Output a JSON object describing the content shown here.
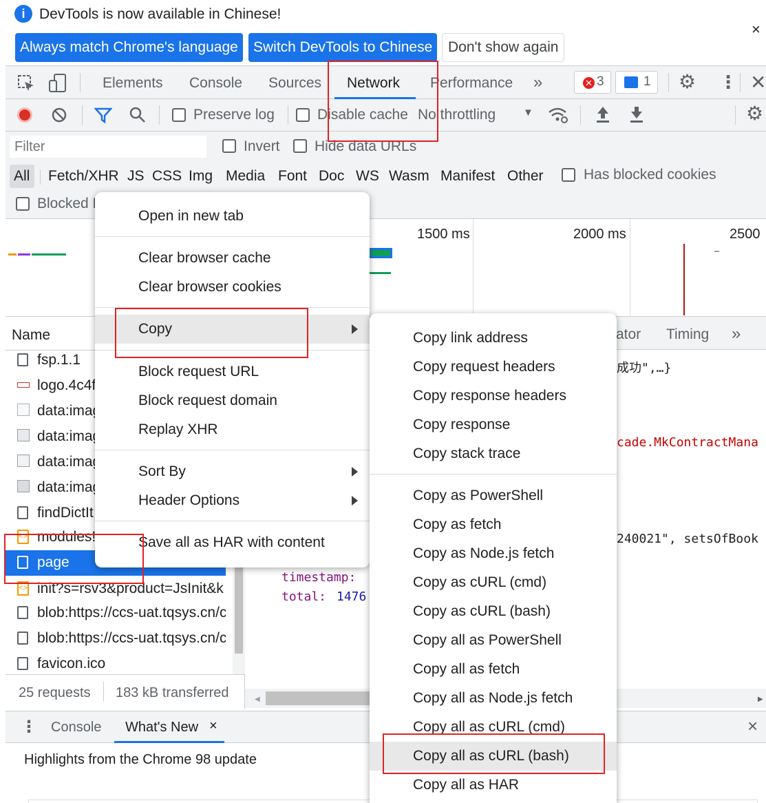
{
  "infobar": {
    "message": "DevTools is now available in Chinese!",
    "btn_match": "Always match Chrome's language",
    "btn_switch": "Switch DevTools to Chinese",
    "btn_dont_show": "Don't show again",
    "close": "×"
  },
  "tabs": {
    "elements": "Elements",
    "console": "Console",
    "sources": "Sources",
    "network": "Network",
    "performance": "Performance",
    "more": "»",
    "errors_count": "3",
    "messages_count": "1"
  },
  "netbar": {
    "preserve_log": "Preserve log",
    "disable_cache": "Disable cache",
    "throttling": "No throttling"
  },
  "filter": {
    "placeholder": "Filter",
    "invert": "Invert",
    "hide_data_urls": "Hide data URLs",
    "types": [
      "All",
      "Fetch/XHR",
      "JS",
      "CSS",
      "Img",
      "Media",
      "Font",
      "Doc",
      "WS",
      "Wasm",
      "Manifest",
      "Other"
    ],
    "has_blocked_cookies": "Has blocked cookies",
    "blocked_requests": "Blocked R"
  },
  "overview": {
    "ticks": [
      "1500 ms",
      "2000 ms",
      "2500"
    ]
  },
  "requests": {
    "header": "Name",
    "rows": [
      "fsp.1.1",
      "logo.4c4f",
      "data:imag",
      "data:imag",
      "data:imag",
      "data:imag",
      "findDictIt",
      "modules!",
      "page",
      "init?s=rsv3&product=JsInit&k",
      "blob:https://ccs-uat.tqsys.cn/c",
      "blob:https://ccs-uat.tqsys.cn/c",
      "favicon.ico"
    ],
    "summary_requests": "25 requests",
    "summary_transferred": "183 kB transferred"
  },
  "detail": {
    "tab_initiator": "ator",
    "tab_timing": "Timing",
    "more": "»",
    "line1": "成功\",…}",
    "line2": "cade.MkContractMana",
    "line3": "240021\", setsOfBook",
    "key_timestamp": "timestamp:",
    "key_total": "total:",
    "val_total": "1476"
  },
  "drawer": {
    "tab_console": "Console",
    "tab_whats_new": "What's New",
    "close_tab": "×",
    "close": "×",
    "headline": "Highlights from the Chrome 98 update"
  },
  "context_menu": {
    "open_new_tab": "Open in new tab",
    "clear_cache": "Clear browser cache",
    "clear_cookies": "Clear browser cookies",
    "copy": "Copy",
    "block_url": "Block request URL",
    "block_domain": "Block request domain",
    "replay_xhr": "Replay XHR",
    "sort_by": "Sort By",
    "header_options": "Header Options",
    "save_har": "Save all as HAR with content"
  },
  "copy_submenu": {
    "items_a": [
      "Copy link address",
      "Copy request headers",
      "Copy response headers",
      "Copy response",
      "Copy stack trace"
    ],
    "items_b": [
      "Copy as PowerShell",
      "Copy as fetch",
      "Copy as Node.js fetch",
      "Copy as cURL (cmd)",
      "Copy as cURL (bash)",
      "Copy all as PowerShell",
      "Copy all as fetch",
      "Copy all as Node.js fetch",
      "Copy all as cURL (cmd)",
      "Copy all as cURL (bash)",
      "Copy all as HAR"
    ]
  },
  "colors": {
    "accent": "#1a73e8",
    "annotation_red": "#e32121",
    "selected_row": "#1a73e8",
    "code_key": "#881280",
    "code_string": "#c80000",
    "code_number": "#1a1aa6"
  }
}
